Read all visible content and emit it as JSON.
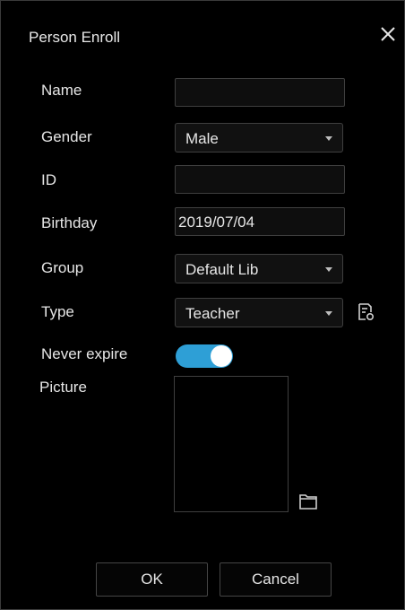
{
  "dialog": {
    "title": "Person Enroll",
    "close_icon": "close-icon"
  },
  "form": {
    "name_label": "Name",
    "name_value": "",
    "gender_label": "Gender",
    "gender_value": "Male",
    "id_label": "ID",
    "id_value": "",
    "birthday_label": "Birthday",
    "birthday_value": "2019/07/04",
    "group_label": "Group",
    "group_value": "Default Lib",
    "type_label": "Type",
    "type_value": "Teacher",
    "type_manage_icon": "document-settings-icon",
    "never_expire_label": "Never expire",
    "never_expire_on": true,
    "picture_label": "Picture",
    "picture_browse_icon": "folder-icon"
  },
  "buttons": {
    "ok": "OK",
    "cancel": "Cancel"
  },
  "colors": {
    "background": "#000000",
    "toggle_on": "#2e9fd6",
    "border": "#3f3f3f",
    "text": "#e6e6e6"
  }
}
